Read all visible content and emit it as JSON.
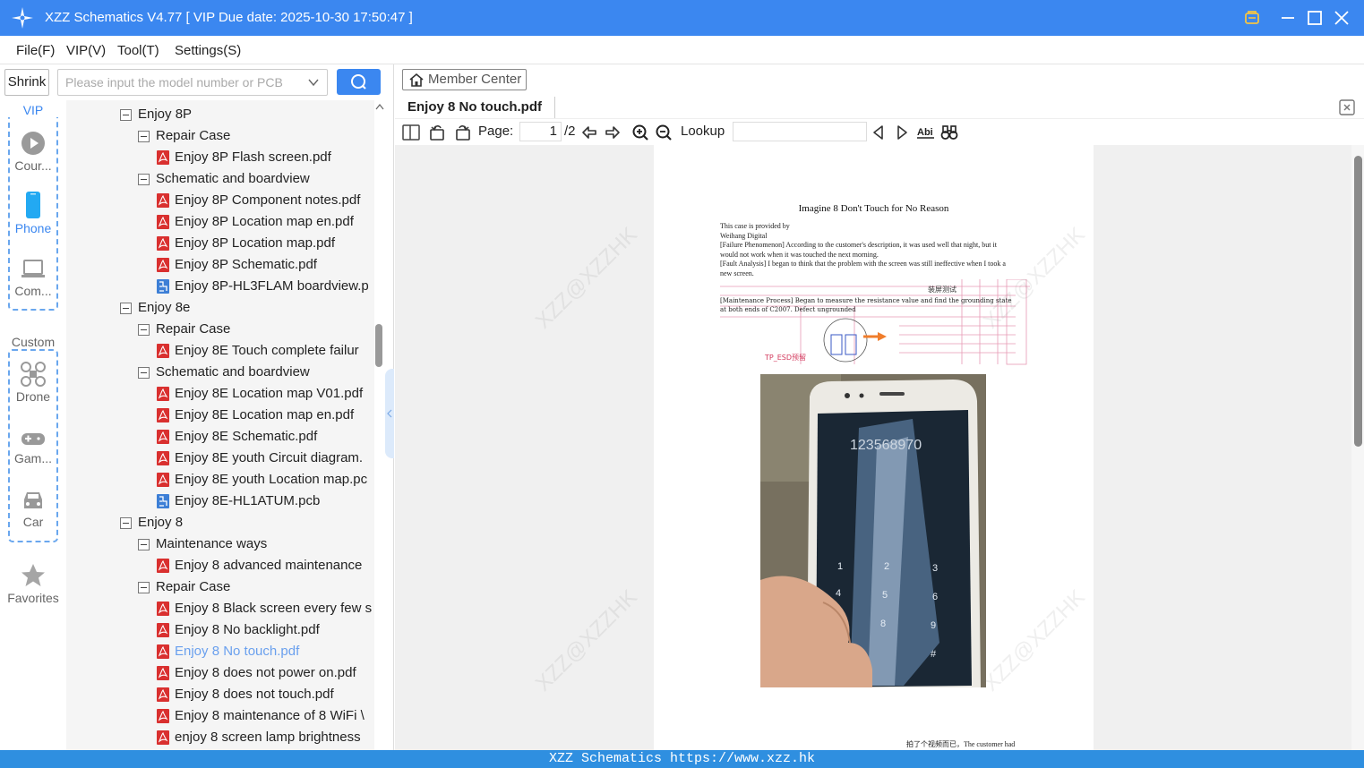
{
  "window": {
    "title": "XZZ Schematics V4.77 [ VIP Due date: 2025-10-30 17:50:47 ]",
    "controls": [
      "vip-icon",
      "minimize-icon",
      "maximize-icon",
      "close-icon"
    ]
  },
  "menu": [
    {
      "label": "File(F)"
    },
    {
      "label": "VIP(V)"
    },
    {
      "label": "Tool(T)"
    },
    {
      "label": "Settings(S)"
    }
  ],
  "left": {
    "shrink_label": "Shrink",
    "search_placeholder": "Please input the model number or PCB",
    "vip_label": "VIP",
    "custom_label": "Custom",
    "categories": [
      {
        "label": "Cour...",
        "icon": "play-icon"
      },
      {
        "label": "Phone",
        "icon": "phone-icon",
        "active": true
      },
      {
        "label": "Com...",
        "icon": "laptop-icon"
      },
      {
        "label": "Drone",
        "icon": "drone-icon"
      },
      {
        "label": "Gam...",
        "icon": "gamepad-icon"
      },
      {
        "label": "Car",
        "icon": "car-icon"
      }
    ],
    "favorites_label": "Favorites",
    "tree": [
      {
        "level": 0,
        "type": "folder",
        "label": "Enjoy 8P"
      },
      {
        "level": 1,
        "type": "folder",
        "label": "Repair Case"
      },
      {
        "level": 2,
        "type": "pdf",
        "label": "Enjoy 8P Flash screen.pdf"
      },
      {
        "level": 1,
        "type": "folder",
        "label": "Schematic and boardview"
      },
      {
        "level": 2,
        "type": "pdf",
        "label": "Enjoy 8P Component notes.pdf"
      },
      {
        "level": 2,
        "type": "pdf",
        "label": "Enjoy 8P Location map en.pdf"
      },
      {
        "level": 2,
        "type": "pdf",
        "label": "Enjoy 8P Location map.pdf"
      },
      {
        "level": 2,
        "type": "pdf",
        "label": "Enjoy 8P Schematic.pdf"
      },
      {
        "level": 2,
        "type": "pcb",
        "label": "Enjoy 8P-HL3FLAM boardview.p"
      },
      {
        "level": 0,
        "type": "folder",
        "label": "Enjoy 8e"
      },
      {
        "level": 1,
        "type": "folder",
        "label": "Repair Case"
      },
      {
        "level": 2,
        "type": "pdf",
        "label": "Enjoy 8E Touch complete failur"
      },
      {
        "level": 1,
        "type": "folder",
        "label": "Schematic and boardview"
      },
      {
        "level": 2,
        "type": "pdf",
        "label": "Enjoy 8E Location map V01.pdf"
      },
      {
        "level": 2,
        "type": "pdf",
        "label": "Enjoy 8E Location map en.pdf"
      },
      {
        "level": 2,
        "type": "pdf",
        "label": "Enjoy 8E Schematic.pdf"
      },
      {
        "level": 2,
        "type": "pdf",
        "label": "Enjoy 8E youth Circuit diagram."
      },
      {
        "level": 2,
        "type": "pdf",
        "label": "Enjoy 8E youth Location map.pc"
      },
      {
        "level": 2,
        "type": "pcb",
        "label": "Enjoy 8E-HL1ATUM.pcb"
      },
      {
        "level": 0,
        "type": "folder",
        "label": "Enjoy 8"
      },
      {
        "level": 1,
        "type": "folder",
        "label": "Maintenance ways"
      },
      {
        "level": 2,
        "type": "pdf",
        "label": "Enjoy 8 advanced maintenance"
      },
      {
        "level": 1,
        "type": "folder",
        "label": "Repair Case"
      },
      {
        "level": 2,
        "type": "pdf",
        "label": "Enjoy 8 Black screen every few s"
      },
      {
        "level": 2,
        "type": "pdf",
        "label": "Enjoy 8 No backlight.pdf"
      },
      {
        "level": 2,
        "type": "pdf",
        "label": "Enjoy 8 No touch.pdf",
        "selected": true
      },
      {
        "level": 2,
        "type": "pdf",
        "label": "Enjoy 8 does not power on.pdf"
      },
      {
        "level": 2,
        "type": "pdf",
        "label": "Enjoy 8 does not touch.pdf"
      },
      {
        "level": 2,
        "type": "pdf",
        "label": "Enjoy 8 maintenance of 8 WiFi \\"
      },
      {
        "level": 2,
        "type": "pdf",
        "label": "enjoy 8 screen lamp brightness"
      }
    ]
  },
  "right": {
    "member_center_label": "Member Center",
    "active_tab": "Enjoy 8 No touch.pdf",
    "toolbar": {
      "page_label": "Page:",
      "page_value": "1",
      "page_total": "/2",
      "lookup_label": "Lookup",
      "lookup_value": ""
    },
    "pdf": {
      "title": "Imagine 8 Don't Touch for No Reason",
      "lines": [
        "This case is provided by",
        "Weihang Digital",
        "[Failure Phenomenon] According to the customer's description, it was used well that night, but it",
        "would not work when it was touched the next morning.",
        "[Fault Analysis] I began to think that the problem with the screen was still ineffective when I took a",
        "new screen."
      ],
      "overlay_label": "装屏测试",
      "process_lines": [
        "[Maintenance Process] Began to measure the resistance value and find the grounding state",
        "at both ends of C2007. Defect ungrounded"
      ],
      "schematic_label": "TP_ESD预留",
      "phone_display": "123568970",
      "footer": "拍了个视频而已，The customer had",
      "watermark": "XZZ@XZZHK"
    }
  },
  "statusbar": {
    "text": "XZZ Schematics https://www.xzz.hk"
  },
  "colors": {
    "accent": "#3b87f0",
    "statusbar": "#2f8fe0",
    "selected_item": "#6aa0ee",
    "pdf_icon": "#d9302f",
    "pcb_icon": "#3d7fd6"
  }
}
